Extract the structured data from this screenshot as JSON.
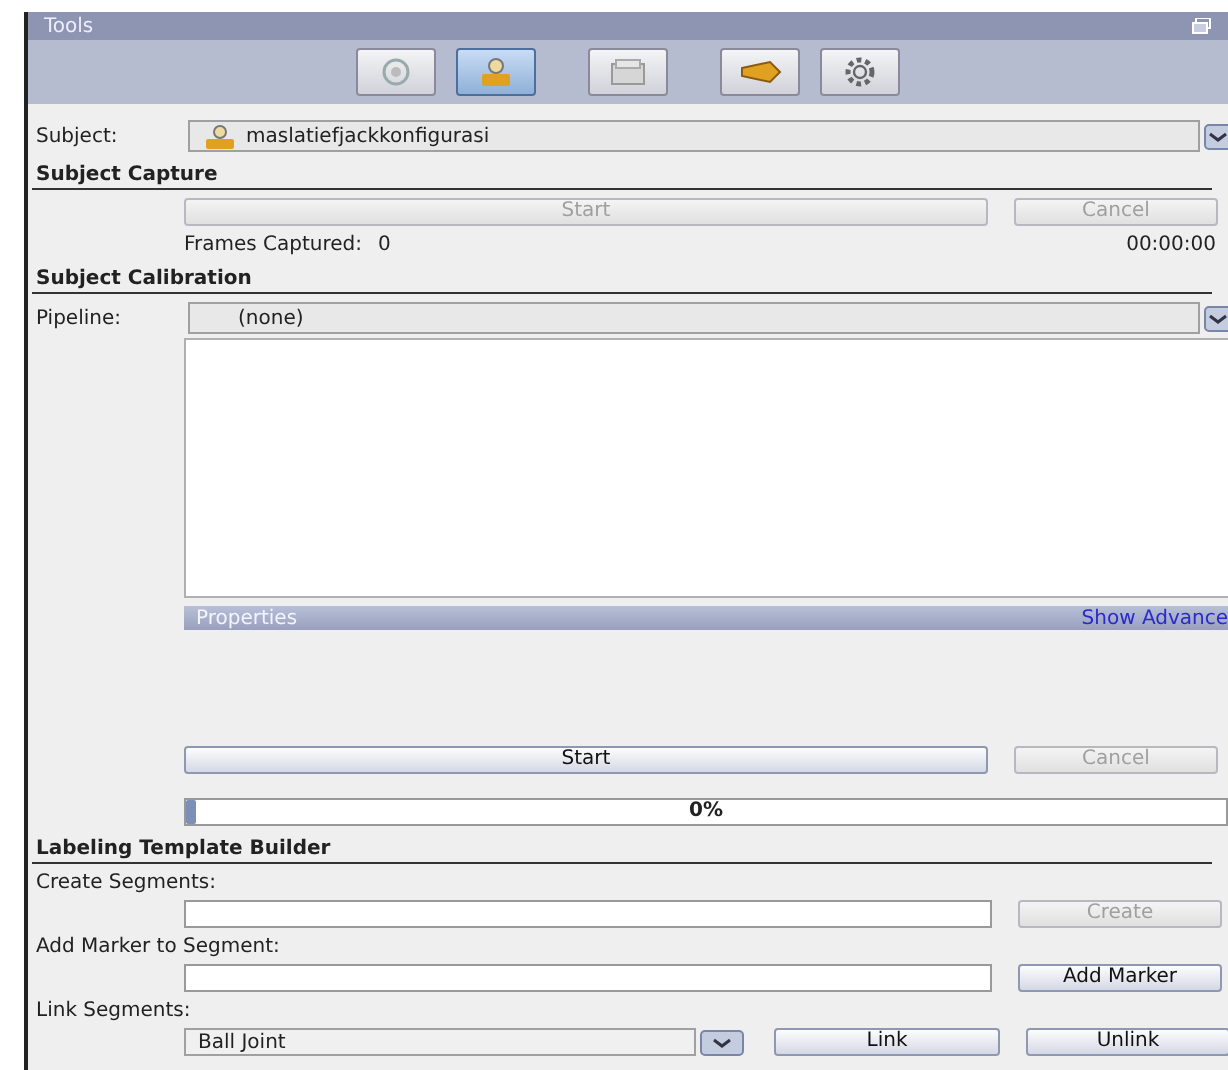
{
  "window": {
    "title": "Tools"
  },
  "toolbar": [
    {
      "kind": "camera",
      "selected": false
    },
    {
      "kind": "subject",
      "selected": true
    },
    {
      "kind": "folder",
      "selected": false
    },
    {
      "kind": "tag",
      "selected": false
    },
    {
      "kind": "gear",
      "selected": false
    }
  ],
  "subject": {
    "label": "Subject:",
    "value": "maslatiefjackkonfigurasi"
  },
  "subject_capture": {
    "title": "Subject Capture",
    "start": {
      "label": "Start",
      "disabled": true
    },
    "cancel": {
      "label": "Cancel",
      "disabled": true
    },
    "frames_label": "Frames Captured:",
    "frames_value": "0",
    "time": "00:00:00"
  },
  "subject_calibration": {
    "title": "Subject Calibration",
    "pipeline_label": "Pipeline:",
    "pipeline_value": "(none)",
    "properties": "Properties",
    "show_advanced": "Show Advance",
    "start": {
      "label": "Start",
      "disabled": false
    },
    "cancel": {
      "label": "Cancel",
      "disabled": true
    },
    "progress": {
      "level": 0.01,
      "reading": "0%"
    }
  },
  "labeling": {
    "title": "Labeling Template Builder",
    "create_label": "Create Segments:",
    "create": {
      "label": "Create",
      "disabled": true
    },
    "add_label": "Add Marker to Segment:",
    "add": {
      "label": "Add Marker",
      "disabled": false
    },
    "link_label": "Link Segments:",
    "link_value": "Ball Joint",
    "link": {
      "label": "Link",
      "disabled": false
    },
    "unlink": {
      "label": "Unlink",
      "disabled": false
    }
  }
}
